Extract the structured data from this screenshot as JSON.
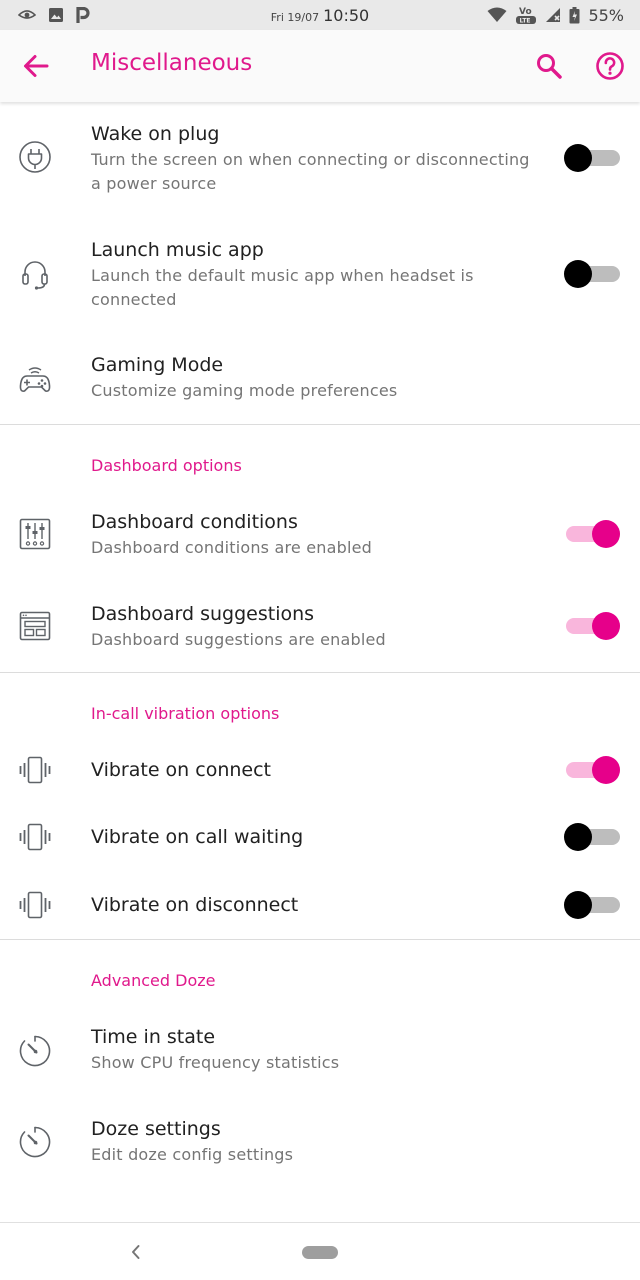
{
  "status_bar": {
    "date": "Fri 19/07",
    "time": "10:50",
    "network_badge_top": "Vo",
    "network_badge_bottom": "LTE",
    "battery": "55%",
    "left_icons": [
      "eye-icon",
      "image-icon",
      "p-icon"
    ],
    "right_icons": [
      "wifi-icon",
      "volte-icon",
      "signal-icon",
      "battery-icon"
    ]
  },
  "app_bar": {
    "title": "Miscellaneous"
  },
  "items": {
    "wake_on_plug": {
      "title": "Wake on plug",
      "subtitle": "Turn the screen on when connecting or disconnecting a power source",
      "enabled": false
    },
    "launch_music": {
      "title": "Launch music app",
      "subtitle": "Launch the default music app when headset is connected",
      "enabled": false
    },
    "gaming_mode": {
      "title": "Gaming Mode",
      "subtitle": "Customize gaming mode preferences"
    },
    "dash_conditions": {
      "title": "Dashboard conditions",
      "subtitle": "Dashboard conditions are enabled",
      "enabled": true
    },
    "dash_suggestions": {
      "title": "Dashboard suggestions",
      "subtitle": "Dashboard suggestions are enabled",
      "enabled": true
    },
    "vibrate_connect": {
      "title": "Vibrate on connect",
      "enabled": true
    },
    "vibrate_waiting": {
      "title": "Vibrate on call waiting",
      "enabled": false
    },
    "vibrate_disconnect": {
      "title": "Vibrate on disconnect",
      "enabled": false
    },
    "time_in_state": {
      "title": "Time in state",
      "subtitle": "Show CPU frequency statistics"
    },
    "doze_settings": {
      "title": "Doze settings",
      "subtitle": "Edit doze config settings"
    }
  },
  "sections": {
    "dashboard": "Dashboard options",
    "incall": "In-call vibration options",
    "doze": "Advanced Doze"
  },
  "colors": {
    "accent": "#e0198c",
    "switch_on_thumb": "#e6008a",
    "switch_on_track": "#f9b6dc",
    "switch_off_thumb": "#000000",
    "switch_off_track": "#bdbdbd"
  }
}
